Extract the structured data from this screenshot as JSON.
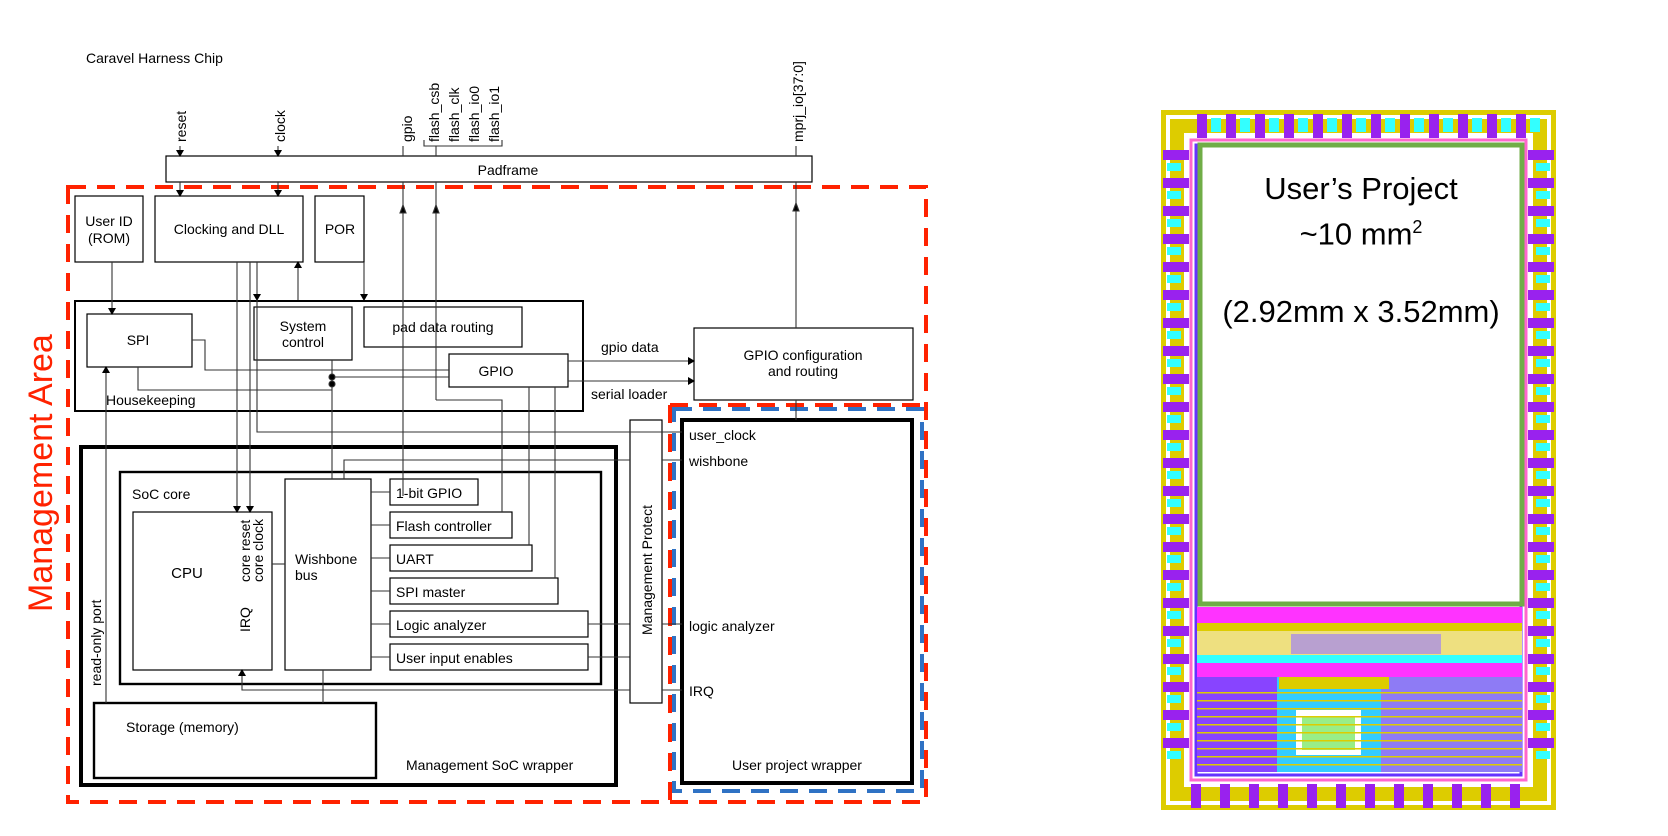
{
  "diagram": {
    "title": "Caravel Harness Chip",
    "area_label": "Management Area",
    "colors": {
      "management_dash": "#ff2200",
      "user_dash": "#2f72c4",
      "line": "#000000"
    },
    "pins": {
      "reset": "reset",
      "clock": "clock",
      "gpio": "gpio",
      "flash_csb": "flash_csb",
      "flash_clk": "flash_clk",
      "flash_io0": "flash_io0",
      "flash_io1": "flash_io1",
      "mprj_io": "mprj_io[37:0]"
    },
    "blocks": {
      "padframe": "Padframe",
      "user_id_line1": "User ID",
      "user_id_line2": "(ROM)",
      "clocking": "Clocking and DLL",
      "por": "POR",
      "spi": "SPI",
      "system_control_line1": "System",
      "system_control_line2": "control",
      "pad_data_routing": "pad data routing",
      "gpio": "GPIO",
      "housekeeping": "Housekeeping",
      "gpio_config_line1": "GPIO configuration",
      "gpio_config_line2": "and routing",
      "soc_core": "SoC core",
      "cpu": "CPU",
      "core_reset": "core reset",
      "core_clock": "core clock",
      "irq": "IRQ",
      "wishbone_line1": "Wishbone",
      "wishbone_line2": "bus",
      "peripherals": [
        "1-bit GPIO",
        "Flash controller",
        "UART",
        "SPI master",
        "Logic analyzer",
        "User input enables"
      ],
      "read_only_port": "read-only port",
      "storage": "Storage (memory)",
      "mgmt_soc_wrapper": "Management SoC wrapper",
      "mgmt_protect": "Management Protect",
      "user_project_wrapper": "User project wrapper"
    },
    "signals": {
      "gpio_data": "gpio data",
      "serial_loader": "serial loader",
      "user_clock": "user_clock",
      "wishbone": "wishbone",
      "logic_analyzer": "logic analyzer",
      "irq": "IRQ"
    }
  },
  "layout_image": {
    "title_line1": "User’s Project",
    "title_line2": "~10 mm",
    "superscript": "2",
    "dimensions": "(2.92mm x 3.52mm)",
    "colors": {
      "pad_yellow": "#ddcc00",
      "pad_purple": "#9922ee",
      "boundary_green": "#70ad47",
      "magenta": "#ff33ff",
      "cyan": "#33ffff",
      "blue": "#6633ff",
      "sram_green": "#99ee88"
    }
  }
}
